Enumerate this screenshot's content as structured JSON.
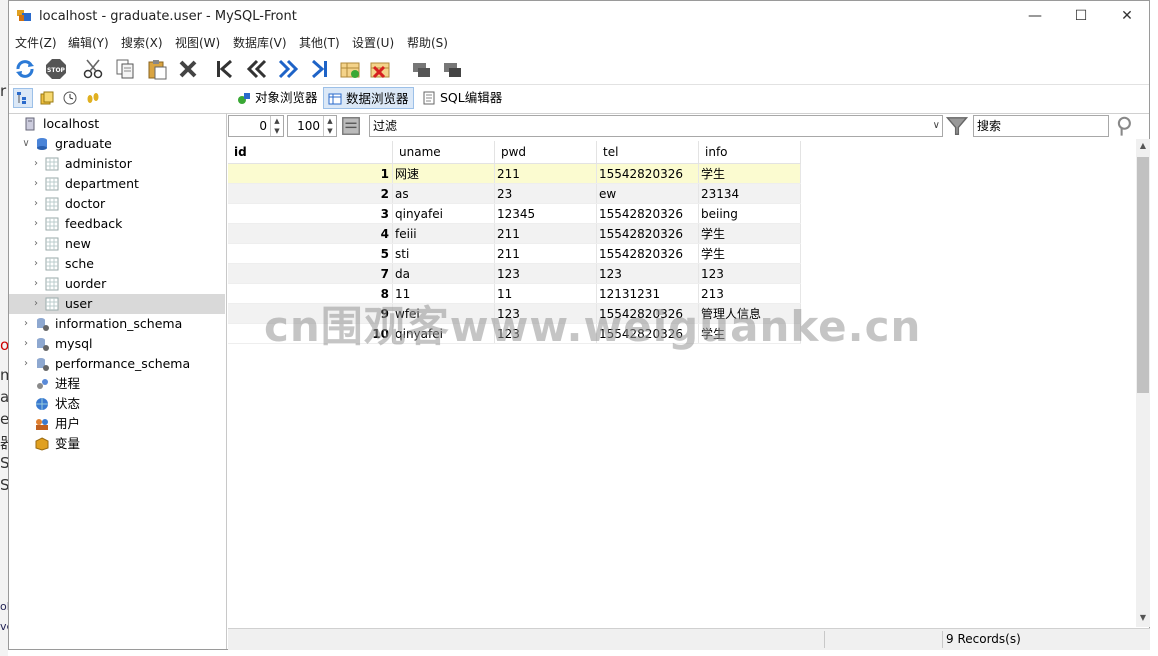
{
  "window": {
    "title": "localhost - graduate.user - MySQL-Front",
    "controls": [
      "—",
      "☐",
      "✕"
    ]
  },
  "menu": [
    "文件(Z)",
    "编辑(Y)",
    "搜索(X)",
    "视图(W)",
    "数据库(V)",
    "其他(T)",
    "设置(U)",
    "帮助(S)"
  ],
  "toolbar": {
    "icons": [
      "refresh-icon",
      "stop-icon",
      "cut-icon",
      "copy-icon",
      "paste-icon",
      "delete-icon",
      "first-icon",
      "prev-icon",
      "next-icon",
      "last-icon",
      "insert-record-icon",
      "delete-record-icon",
      "post-icon",
      "cancel-icon"
    ],
    "stop_label": "STOP"
  },
  "tree": [
    {
      "label": "localhost",
      "level": 0,
      "expander": "",
      "icon": "server"
    },
    {
      "label": "graduate",
      "level": 1,
      "expander": "v",
      "icon": "db"
    },
    {
      "label": "administor",
      "level": 2,
      "expander": ">",
      "icon": "table"
    },
    {
      "label": "department",
      "level": 2,
      "expander": ">",
      "icon": "table"
    },
    {
      "label": "doctor",
      "level": 2,
      "expander": ">",
      "icon": "table"
    },
    {
      "label": "feedback",
      "level": 2,
      "expander": ">",
      "icon": "table"
    },
    {
      "label": "new",
      "level": 2,
      "expander": ">",
      "icon": "table"
    },
    {
      "label": "sche",
      "level": 2,
      "expander": ">",
      "icon": "table"
    },
    {
      "label": "uorder",
      "level": 2,
      "expander": ">",
      "icon": "table"
    },
    {
      "label": "user",
      "level": 2,
      "expander": ">",
      "icon": "table",
      "selected": true
    },
    {
      "label": "information_schema",
      "level": 1,
      "expander": ">",
      "icon": "sysdb"
    },
    {
      "label": "mysql",
      "level": 1,
      "expander": ">",
      "icon": "sysdb"
    },
    {
      "label": "performance_schema",
      "level": 1,
      "expander": ">",
      "icon": "sysdb"
    },
    {
      "label": "进程",
      "level": 1,
      "expander": "",
      "icon": "process"
    },
    {
      "label": "状态",
      "level": 1,
      "expander": "",
      "icon": "status"
    },
    {
      "label": "用户",
      "level": 1,
      "expander": "",
      "icon": "users"
    },
    {
      "label": "变量",
      "level": 1,
      "expander": "",
      "icon": "variables"
    }
  ],
  "view_tabs": {
    "object_browser": "对象浏览器",
    "data_browser": "数据浏览器",
    "sql_editor": "SQL编辑器"
  },
  "filterbar": {
    "offset": "0",
    "limit": "100",
    "filter_placeholder": "过滤",
    "search_placeholder": "搜索"
  },
  "grid": {
    "columns": [
      "id",
      "uname",
      "pwd",
      "tel",
      "info"
    ],
    "rows": [
      [
        "1",
        "网速",
        "211",
        "15542820326",
        "学生"
      ],
      [
        "2",
        "as",
        "23",
        "ew",
        "23134"
      ],
      [
        "3",
        "qinyafei",
        "12345",
        "15542820326",
        "beiing"
      ],
      [
        "4",
        "feiii",
        "211",
        "15542820326",
        "学生"
      ],
      [
        "5",
        "sti",
        "211",
        "15542820326",
        "学生"
      ],
      [
        "7",
        "da",
        "123",
        "123",
        "123"
      ],
      [
        "8",
        "11",
        "11",
        "12131231",
        "213"
      ],
      [
        "9",
        "wfei",
        "123",
        "15542820326",
        "管理人信息"
      ],
      [
        "10",
        "qinyafei",
        "123",
        "15542820326",
        "学生"
      ]
    ]
  },
  "status": {
    "records": "9 Records(s)"
  },
  "watermark": "cn围观客www.weiguanke.cn",
  "background_fragments": [
    "r",
    "o",
    "m",
    "a",
    "e",
    "器",
    "S",
    "Se",
    "oli",
    "ve"
  ]
}
